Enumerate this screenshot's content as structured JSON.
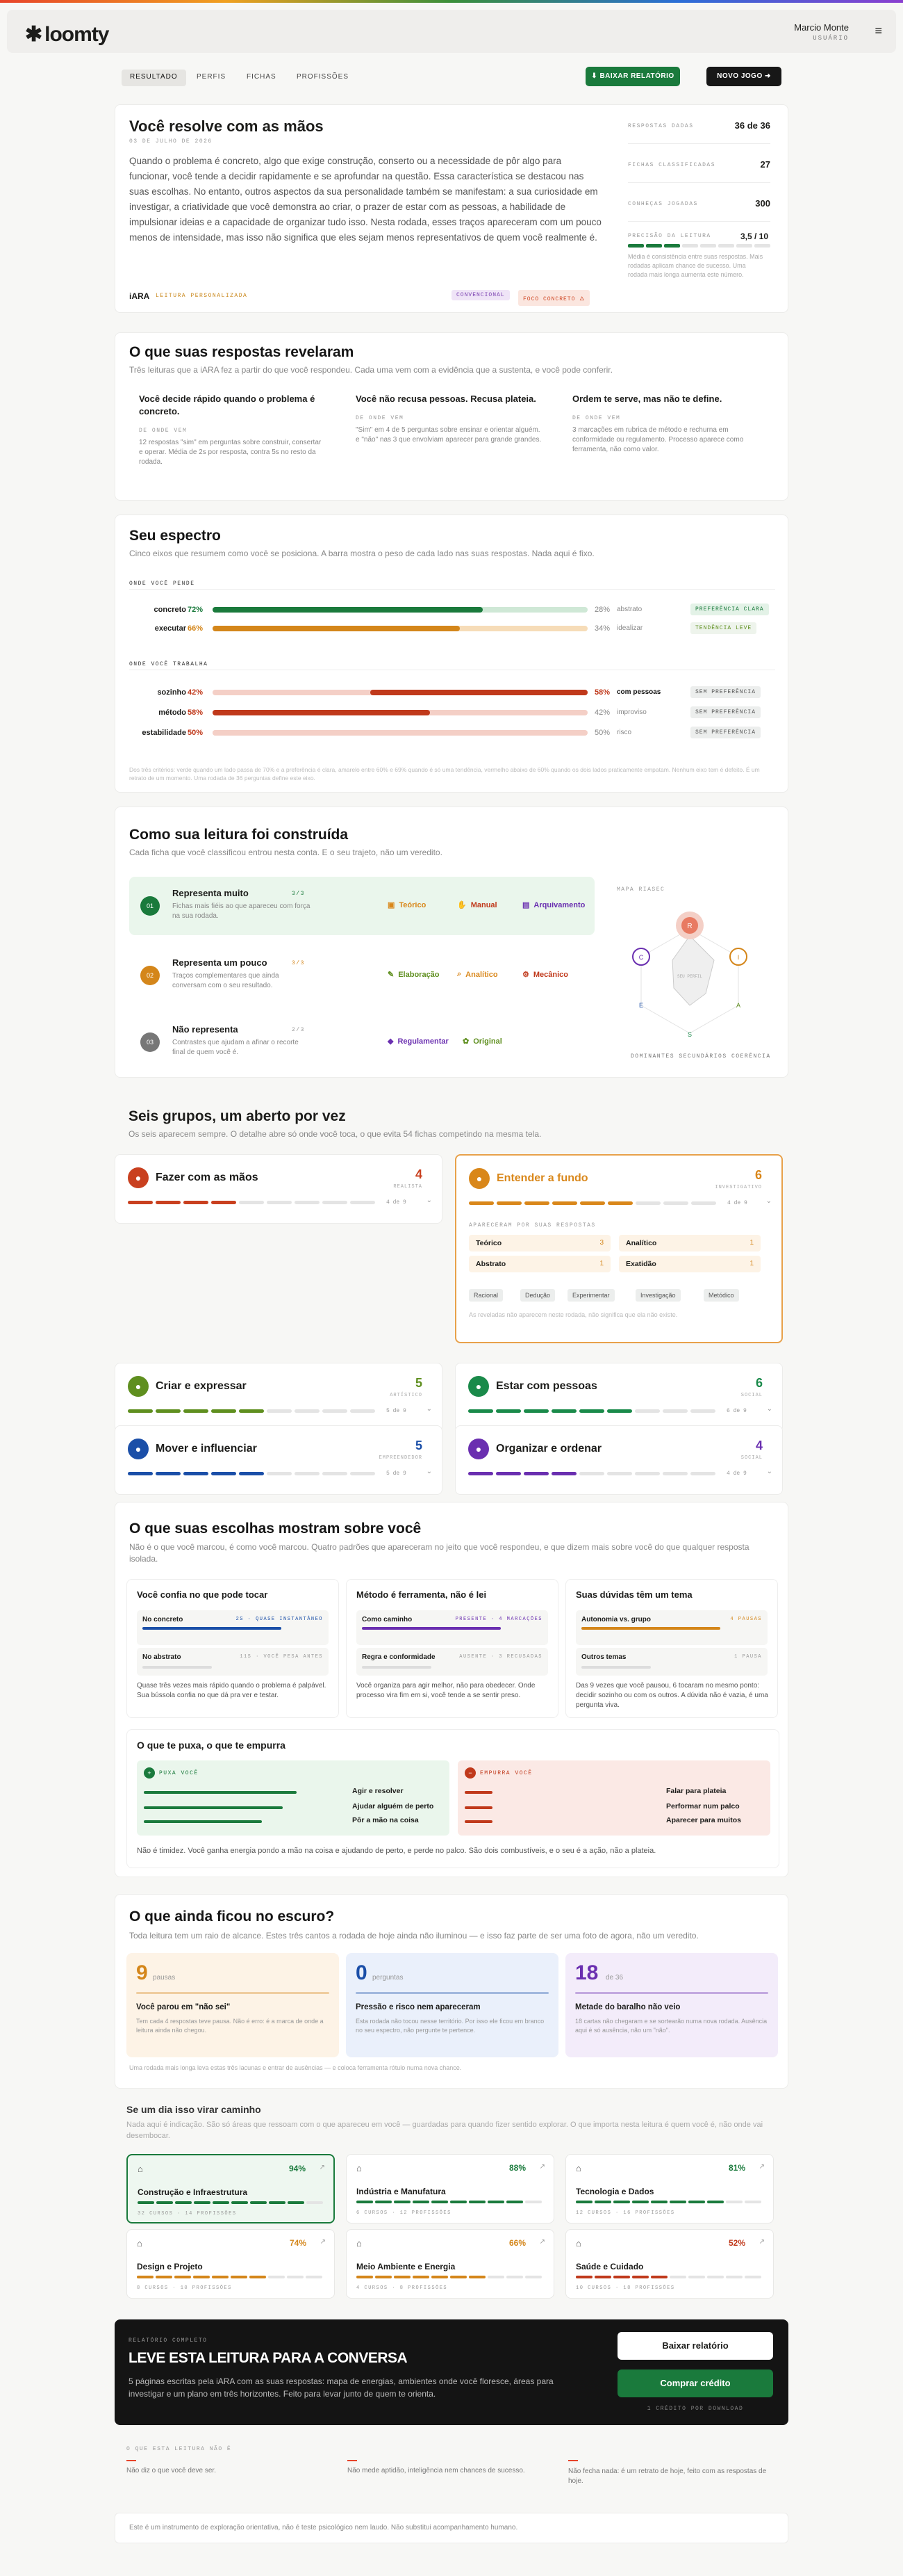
{
  "app": {
    "logo": "loomty",
    "user_name": "Marcio Monte",
    "user_role": "USUÁRIO"
  },
  "nav": {
    "tabs": [
      "RESULTADO",
      "PERFIS",
      "FICHAS",
      "PROFISSÕES"
    ],
    "download_label": "BAIXAR RELATÓRIO",
    "new_game_label": "NOVO JOGO"
  },
  "intro": {
    "title": "Você resolve com as mãos",
    "date": "03 DE JULHO DE 2026",
    "body": "Quando o problema é concreto, algo que exige construção, conserto ou a necessidade de pôr algo para funcionar, você tende a decidir rapidamente e se aprofundar na questão. Essa característica se destacou nas suas escolhas. No entanto, outros aspectos da sua personalidade também se manifestam: a sua curiosidade em investigar, a criatividade que você demonstra ao criar, o prazer de estar com as pessoas, a habilidade de impulsionar ideias e a capacidade de organizar tudo isso. Nesta rodada, esses traços apareceram com um pouco menos de intensidade, mas isso não significa que eles sejam menos representativos de quem você realmente é.",
    "brand": "iARA",
    "brand_tag": "LEITURA PERSONALIZADA",
    "badge1": "CONVENCIONAL",
    "badge2": "FOCO CONCRETO",
    "stats": [
      {
        "label": "RESPOSTAS DADAS",
        "value": "36 de 36"
      },
      {
        "label": "FICHAS CLASSIFICADAS",
        "value": "27"
      },
      {
        "label": "CONHEÇAS JOGADAS",
        "value": "300"
      }
    ],
    "reading_label": "PRECISÃO DA LEITURA",
    "reading_value": "3,5 / 10",
    "reading_level": 0.35,
    "reading_note": "Média é consistência entre suas respostas. Mais rodadas aplicam chance de sucesso. Uma rodada mais longa aumenta este número."
  },
  "reveal": {
    "title": "O que suas respostas revelaram",
    "subtitle": "Três leituras que a iARA fez a partir do que você respondeu. Cada uma vem com a evidência que a sustenta, e você pode conferir.",
    "items": [
      {
        "title": "Você decide rápido quando o problema é concreto.",
        "label": "DE ONDE VEM",
        "text": "12 respostas \"sim\" em perguntas sobre construir, consertar e operar. Média de 2s por resposta, contra 5s no resto da rodada."
      },
      {
        "title": "Você não recusa pessoas. Recusa plateia.",
        "label": "DE ONDE VEM",
        "text": "\"Sim\" em 4 de 5 perguntas sobre ensinar e orientar alguém. e \"não\" nas 3 que envolviam aparecer para grande grandes."
      },
      {
        "title": "Ordem te serve, mas não te define.",
        "label": "DE ONDE VEM",
        "text": "3 marcações em rubrica de método e rechurna em conformidade ou regulamento. Processo aparece como ferramenta, não como valor."
      }
    ]
  },
  "spectrum": {
    "title": "Seu espectro",
    "subtitle": "Cinco eixos que resumem como você se posiciona. A barra mostra o peso de cada lado nas suas respostas. Nada aqui é fixo.",
    "group1_label": "ONDE VOCÊ PENDE",
    "group2_label": "ONDE VOCÊ TRABALHA",
    "rows": [
      {
        "left": "concreto",
        "lv": "72%",
        "lf": 0.72,
        "rv": "28%",
        "right": "abstrato",
        "chip": "PREFERÊNCIA CLARA",
        "color": "#1a7a3c",
        "soft": "#cfe8d6"
      },
      {
        "left": "executar",
        "lv": "66%",
        "lf": 0.66,
        "rv": "34%",
        "right": "idealizar",
        "chip": "TENDÊNCIA LEVE",
        "color": "#d4861a",
        "soft": "#f6dcb8"
      },
      {
        "left": "sozinho",
        "lv": "42%",
        "lf": 0.42,
        "rv": "58%",
        "right": "com pessoas",
        "chip": "SEM PREFERÊNCIA",
        "color": "#c0391b",
        "soft": "#f4cfc6"
      },
      {
        "left": "método",
        "lv": "58%",
        "lf": 0.58,
        "rv": "42%",
        "right": "improviso",
        "chip": "SEM PREFERÊNCIA",
        "color": "#c0391b",
        "soft": "#f4cfc6"
      },
      {
        "left": "estabilidade",
        "lv": "50%",
        "lf": 0.5,
        "rv": "50%",
        "right": "risco",
        "chip": "SEM PREFERÊNCIA",
        "color": "#c0391b",
        "soft": "#f4cfc6"
      }
    ],
    "note": "Dos três critérios: verde quando um lado passa de 70% e a preferência é clara, amarelo entre 60% e 69% quando é só uma tendência, vermelho abaixo de 60% quando os dois lados praticamente empatam. Nenhum eixo tem é defeito. É um retrato de um momento. Uma rodada de 36 perguntas define este eixo."
  },
  "built": {
    "title": "Como sua leitura foi construída",
    "subtitle": "Cada ficha que você classificou entrou nesta conta. E o seu trajeto, não um veredito.",
    "tiers": [
      {
        "num": "01",
        "title": "Representa muito",
        "count": "3/3",
        "text": "Fichas mais fiéis ao que apareceu com força na sua rodada.",
        "pills": [
          "Teórico",
          "Manual",
          "Arquivamento"
        ]
      },
      {
        "num": "02",
        "title": "Representa um pouco",
        "count": "3/3",
        "text": "Traços complementares que ainda conversam com o seu resultado.",
        "pills": [
          "Elaboração",
          "Analítico",
          "Mecânico"
        ]
      },
      {
        "num": "03",
        "title": "Não representa",
        "count": "2/3",
        "text": "Contrastes que ajudam a afinar o recorte final de quem você é.",
        "pills": [
          "Regulamentar",
          "Original"
        ]
      }
    ],
    "map_label": "MAPA RIASEC",
    "map_center": "SEU PERFIL",
    "map_nodes": [
      "R",
      "I",
      "A",
      "S",
      "E",
      "C"
    ],
    "map_legend": [
      "Dominantes",
      "Secundários",
      "Coerência"
    ]
  },
  "groups": {
    "title": "Seis grupos, um aberto por vez",
    "subtitle": "Os seis aparecem sempre. O detalhe abre só onde você toca, o que evita 54 fichas competindo na mesma tela.",
    "items": [
      {
        "name": "Fazer com as mãos",
        "num": "4",
        "lbl": "REALISTA",
        "count": "4 de 9",
        "color": "#c9401f"
      },
      {
        "name": "Entender a fundo",
        "num": "6",
        "lbl": "INVESTIGATIVO",
        "count": "4 de 9",
        "color": "#d9871a"
      },
      {
        "name": "Criar e expressar",
        "num": "5",
        "lbl": "ARTÍSTICO",
        "count": "5 de 9",
        "color": "#5f8f1f"
      },
      {
        "name": "Estar com pessoas",
        "num": "6",
        "lbl": "SOCIAL",
        "count": "6 de 9",
        "color": "#1a8a4a"
      },
      {
        "name": "Mover e influenciar",
        "num": "5",
        "lbl": "EMPREENDEDOR",
        "count": "5 de 9",
        "color": "#1b4fa8"
      },
      {
        "name": "Organizar e ordenar",
        "num": "4",
        "lbl": "SOCIAL",
        "count": "4 de 9",
        "color": "#6a2fb0"
      }
    ],
    "open_label": "APARECERAM POR SUAS RESPOSTAS",
    "open_items": [
      {
        "n": "Teórico",
        "v": "3"
      },
      {
        "n": "Analítico",
        "v": "1"
      },
      {
        "n": "Abstrato",
        "v": "1"
      },
      {
        "n": "Exatidão",
        "v": "1"
      }
    ],
    "open_chips": [
      "Racional",
      "Dedução",
      "Experimentar",
      "Investigação",
      "Metódico"
    ],
    "open_note": "As reveladas não aparecem neste rodada, não significa que ela não existe."
  },
  "choices": {
    "title": "O que suas escolhas mostram sobre você",
    "subtitle": "Não é o que você marcou, é como você marcou. Quatro padrões que apareceram no jeito que você respondeu, e que dizem mais sobre você do que qualquer resposta isolada.",
    "cards": [
      {
        "title": "Você confia no que pode tocar",
        "r1": "No concreto",
        "r1v": "2s · quase instantâneo",
        "r2": "No abstrato",
        "r2v": "11s · você pesa antes",
        "text": "Quase três vezes mais rápido quando o problema é palpável. Sua bússola confia no que dá pra ver e testar."
      },
      {
        "title": "Método é ferramenta, não é lei",
        "r1": "Como caminho",
        "r1v": "PRESENTE · 4 marcações",
        "r2": "Regra e conformidade",
        "r2v": "AUSENTE · 3 recusadas",
        "text": "Você organiza para agir melhor, não para obedecer. Onde processo vira fim em si, você tende a se sentir preso."
      },
      {
        "title": "Suas dúvidas têm um tema",
        "r1": "Autonomia vs. grupo",
        "r1v": "4 pausas",
        "r2": "Outros temas",
        "r2v": "1 pausa",
        "text": "Das 9 vezes que você pausou, 6 tocaram no mesmo ponto: decidir sozinho ou com os outros. A dúvida não é vazia, é uma pergunta viva."
      }
    ],
    "pull_title": "O que te puxa, o que te empurra",
    "pull_label": "PUXA VOCÊ",
    "push_label": "EMPURRA VOCÊ",
    "pulls": [
      "Agir e resolver",
      "Ajudar alguém de perto",
      "Pôr a mão na coisa"
    ],
    "pushes": [
      "Falar para plateia",
      "Performar num palco",
      "Aparecer para muitos"
    ],
    "footer": "Não é timidez. Você ganha energia pondo a mão na coisa e ajudando de perto, e perde no palco. São dois combustíveis, e o seu é a ação, não a plateia."
  },
  "dark": {
    "title": "O que ainda ficou no escuro?",
    "subtitle": "Toda leitura tem um raio de alcance. Estes três cantos a rodada de hoje ainda não iluminou — e isso faz parte de ser uma foto de agora, não um veredito.",
    "cards": [
      {
        "num": "9",
        "unit": "pausas",
        "title": "Você parou em \"não sei\"",
        "text": "Tem cada 4 respostas teve pausa. Não é erro: é a marca de onde a leitura ainda não chegou."
      },
      {
        "num": "0",
        "unit": "perguntas",
        "title": "Pressão e risco nem apareceram",
        "text": "Esta rodada não tocou nesse território. Por isso ele ficou em branco no seu espectro, não pergunte te pertence."
      },
      {
        "num": "18",
        "unit": "de 36",
        "title": "Metade do baralho não veio",
        "text": "18 cartas não chegaram e se sortearão numa nova rodada. Ausência aqui é só ausência, não um \"não\"."
      }
    ],
    "note": "Uma rodada mais longa leva estas três lacunas e entrar de ausências — e coloca ferramenta rótulo numa nova chance."
  },
  "paths": {
    "title": "Se um dia isso virar caminho",
    "subtitle": "Nada aqui é indicação. São só áreas que ressoam com o que apareceu em você — guardadas para quando fizer sentido explorar. O que importa nesta leitura é quem você é, não onde vai desembocar.",
    "items": [
      {
        "name": "Construção e Infraestrutura",
        "pct": "94%",
        "level": 0.94,
        "meta": "32 CURSOS · 14 PROFISSÕES",
        "color": "#1a7a3c"
      },
      {
        "name": "Indústria e Manufatura",
        "pct": "88%",
        "level": 0.88,
        "meta": "6 CURSOS · 12 PROFISSÕES",
        "color": "#1a7a3c"
      },
      {
        "name": "Tecnologia e Dados",
        "pct": "81%",
        "level": 0.81,
        "meta": "12 CURSOS · 16 PROFISSÕES",
        "color": "#1a7a3c"
      },
      {
        "name": "Design e Projeto",
        "pct": "74%",
        "level": 0.74,
        "meta": "8 CURSOS · 10 PROFISSÕES",
        "color": "#d4861a"
      },
      {
        "name": "Meio Ambiente e Energia",
        "pct": "66%",
        "level": 0.66,
        "meta": "4 CURSOS · 8 PROFISSÕES",
        "color": "#d4861a"
      },
      {
        "name": "Saúde e Cuidado",
        "pct": "52%",
        "level": 0.52,
        "meta": "10 CURSOS · 18 PROFISSÕES",
        "color": "#c0391b"
      }
    ]
  },
  "cta": {
    "label": "RELATÓRIO COMPLETO",
    "title": "LEVE ESTA LEITURA PARA A CONVERSA",
    "text": "5 páginas escritas pela iARA com as suas respostas: mapa de energias, ambientes onde você floresce, áreas para investigar e um plano em três horizontes. Feito para levar junto de quem te orienta.",
    "btn1": "Baixar relatório",
    "btn2": "Comprar crédito",
    "note": "1 CRÉDITO POR DOWNLOAD"
  },
  "footer": {
    "label": "O QUE ESTA LEITURA NÃO É",
    "items": [
      "Não diz o que você deve ser.",
      "Não mede aptidão, inteligência nem chances de sucesso.",
      "Não fecha nada: é um retrato de hoje, feito com as respostas de hoje."
    ],
    "disclaimer": "Este é um instrumento de exploração orientativa, não é teste psicológico nem laudo. Não substitui acompanhamento humano."
  }
}
